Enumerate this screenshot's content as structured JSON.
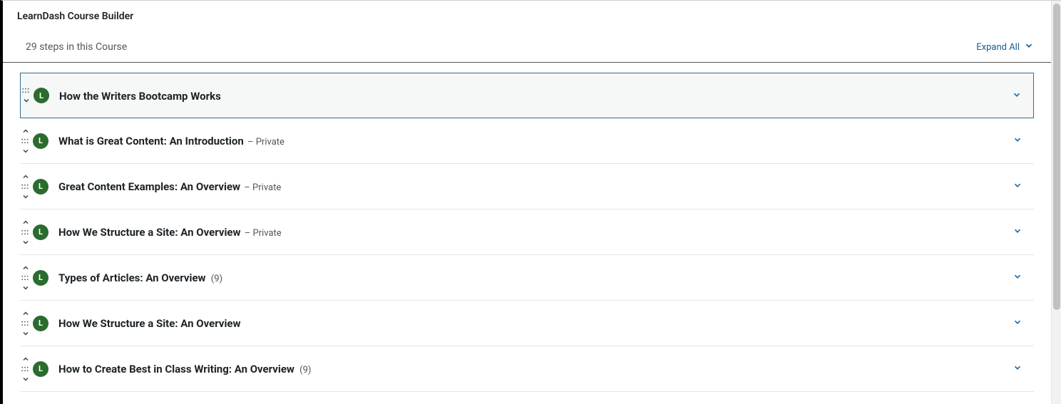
{
  "panel_title": "LearnDash Course Builder",
  "steps_text": "29 steps in this Course",
  "expand_all_label": "Expand All",
  "badge_letter": "L",
  "lessons": [
    {
      "title": "How the Writers Bootcamp Works",
      "suffix": "",
      "count": "",
      "selected": true,
      "has_up": false
    },
    {
      "title": "What is Great Content: An Introduction",
      "suffix": " – Private",
      "count": "",
      "selected": false,
      "has_up": true
    },
    {
      "title": "Great Content Examples: An Overview",
      "suffix": " – Private",
      "count": "",
      "selected": false,
      "has_up": true
    },
    {
      "title": "How We Structure a Site: An Overview",
      "suffix": " – Private",
      "count": "",
      "selected": false,
      "has_up": true
    },
    {
      "title": "Types of Articles: An Overview",
      "suffix": "",
      "count": "(9)",
      "selected": false,
      "has_up": true
    },
    {
      "title": "How We Structure a Site: An Overview",
      "suffix": "",
      "count": "",
      "selected": false,
      "has_up": true
    },
    {
      "title": "How to Create Best in Class Writing: An Overview",
      "suffix": "",
      "count": "(9)",
      "selected": false,
      "has_up": true
    }
  ]
}
